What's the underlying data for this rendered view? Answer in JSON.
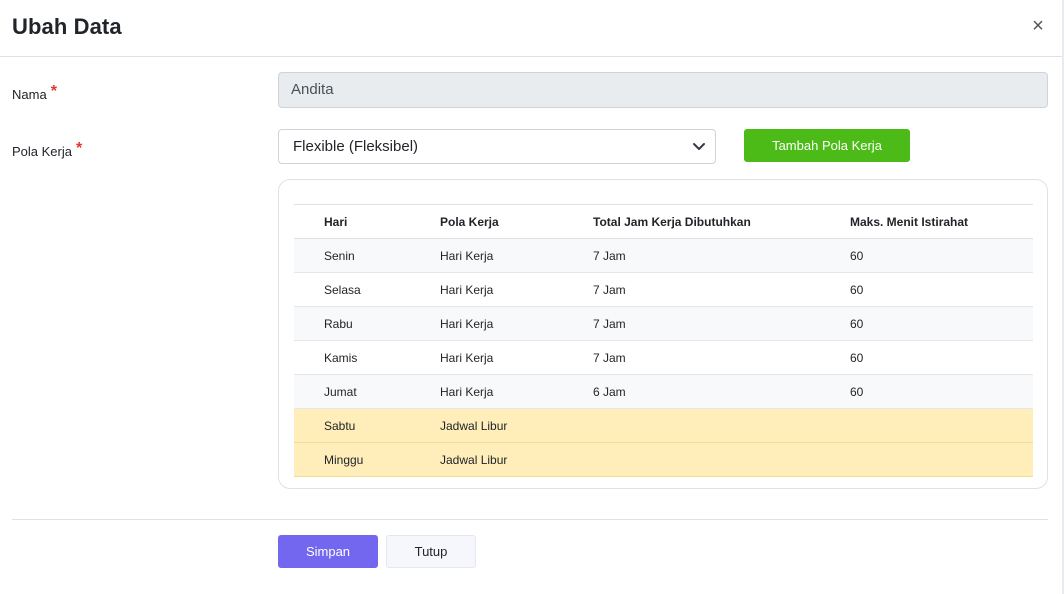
{
  "modal": {
    "title": "Ubah Data",
    "close_label": "×"
  },
  "form": {
    "nama_label": "Nama",
    "nama_value": "Andita",
    "pola_kerja_label": "Pola Kerja",
    "required_mark": "*",
    "pola_kerja_selected": "Flexible (Fleksibel)",
    "add_pattern_button": "Tambah Pola Kerja"
  },
  "table": {
    "headers": [
      "Hari",
      "Pola Kerja",
      "Total Jam Kerja Dibutuhkan",
      "Maks. Menit Istirahat"
    ],
    "rows": [
      {
        "hari": "Senin",
        "pola": "Hari Kerja",
        "jam": "7 Jam",
        "istirahat": "60"
      },
      {
        "hari": "Selasa",
        "pola": "Hari Kerja",
        "jam": "7 Jam",
        "istirahat": "60"
      },
      {
        "hari": "Rabu",
        "pola": "Hari Kerja",
        "jam": "7 Jam",
        "istirahat": "60"
      },
      {
        "hari": "Kamis",
        "pola": "Hari Kerja",
        "jam": "7 Jam",
        "istirahat": "60"
      },
      {
        "hari": "Jumat",
        "pola": "Hari Kerja",
        "jam": "6 Jam",
        "istirahat": "60"
      },
      {
        "hari": "Sabtu",
        "pola": "Jadwal Libur",
        "jam": "",
        "istirahat": ""
      },
      {
        "hari": "Minggu",
        "pola": "Jadwal Libur",
        "jam": "",
        "istirahat": ""
      }
    ]
  },
  "footer": {
    "save_label": "Simpan",
    "close_label": "Tutup"
  },
  "colors": {
    "primary": "#7367f0",
    "success": "#4cbb17",
    "holiday_row": "#ffeeba",
    "required": "#e3342f"
  },
  "icons": {
    "close": "close-icon",
    "select_chevron": "chevron-down-icon"
  }
}
